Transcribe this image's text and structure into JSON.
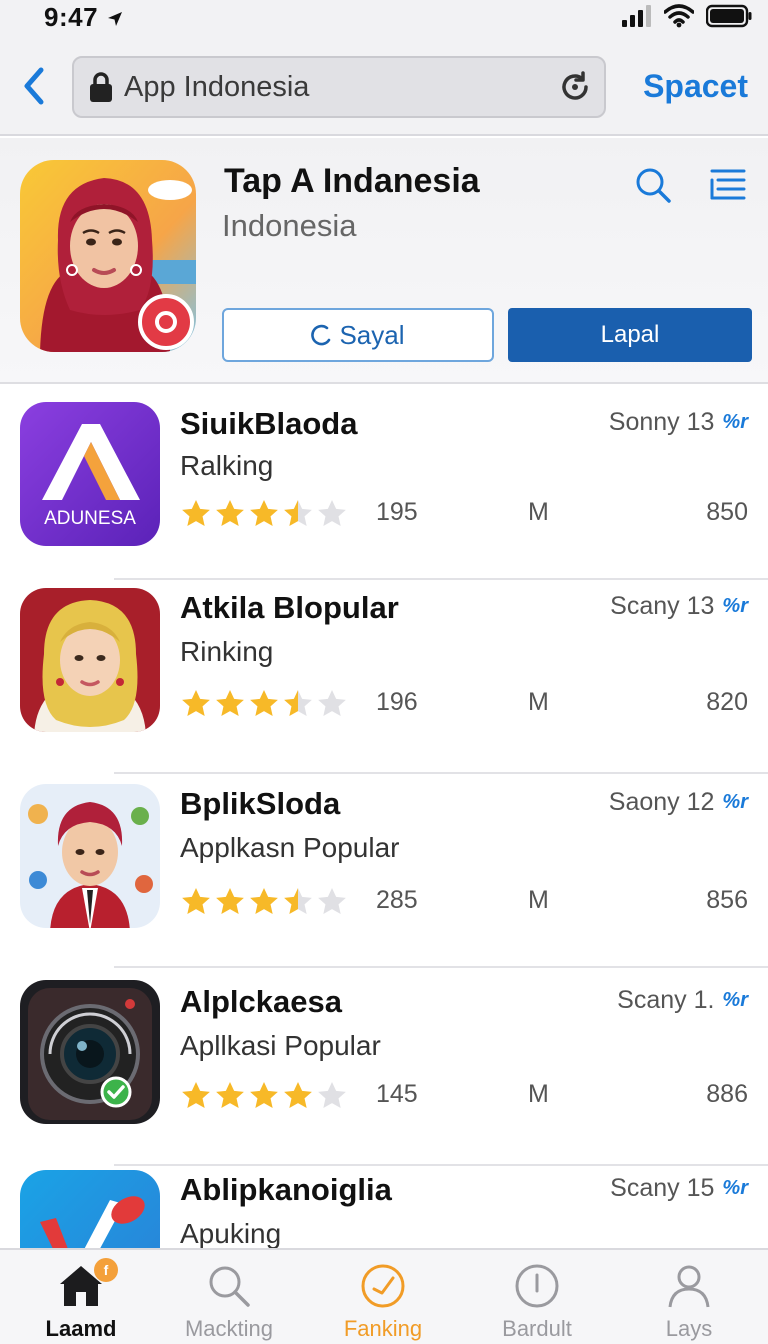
{
  "status_bar": {
    "time": "9:47"
  },
  "nav": {
    "back_icon": "chevron-left-icon",
    "search_value": "App Indonesia",
    "action_label": "Spacet"
  },
  "hero": {
    "title": "Tap A Indanesia",
    "subtitle": "Indonesia",
    "button_outline_label": "Sayal",
    "button_solid_label": "Lapal"
  },
  "apps": [
    {
      "name": "SiuikBlaoda",
      "category": "Ralking",
      "meta": "Sonny 13",
      "tag": "%r",
      "rating": 3.5,
      "count": "195",
      "unit": "M",
      "value": "850",
      "icon_text": "ADUNESA"
    },
    {
      "name": "Atkila Blopular",
      "category": "Rinking",
      "meta": "Scany 13",
      "tag": "%r",
      "rating": 3.5,
      "count": "196",
      "unit": "M",
      "value": "820"
    },
    {
      "name": "BplikSloda",
      "category": "Applkasn Popular",
      "meta": "Saony 12",
      "tag": "%r",
      "rating": 3.5,
      "count": "285",
      "unit": "M",
      "value": "856"
    },
    {
      "name": "Alplckaesa",
      "category": "Apllkasi Popular",
      "meta": "Scany 1.",
      "tag": "%r",
      "rating": 4,
      "count": "145",
      "unit": "M",
      "value": "886"
    },
    {
      "name": "Ablipkanoiglia",
      "category": "Apuking",
      "meta": "Scany 15",
      "tag": "%r"
    }
  ],
  "tabs": [
    {
      "label": "Laamd",
      "icon": "home-icon",
      "badge": "f"
    },
    {
      "label": "Mackting",
      "icon": "search-icon"
    },
    {
      "label": "Fanking",
      "icon": "compass-icon"
    },
    {
      "label": "Bardult",
      "icon": "info-icon"
    },
    {
      "label": "Lays",
      "icon": "person-icon"
    }
  ],
  "colors": {
    "accent": "#1a7ad9",
    "button": "#1a5fae",
    "active_tab": "#f19c27",
    "star": "#f7b928"
  }
}
